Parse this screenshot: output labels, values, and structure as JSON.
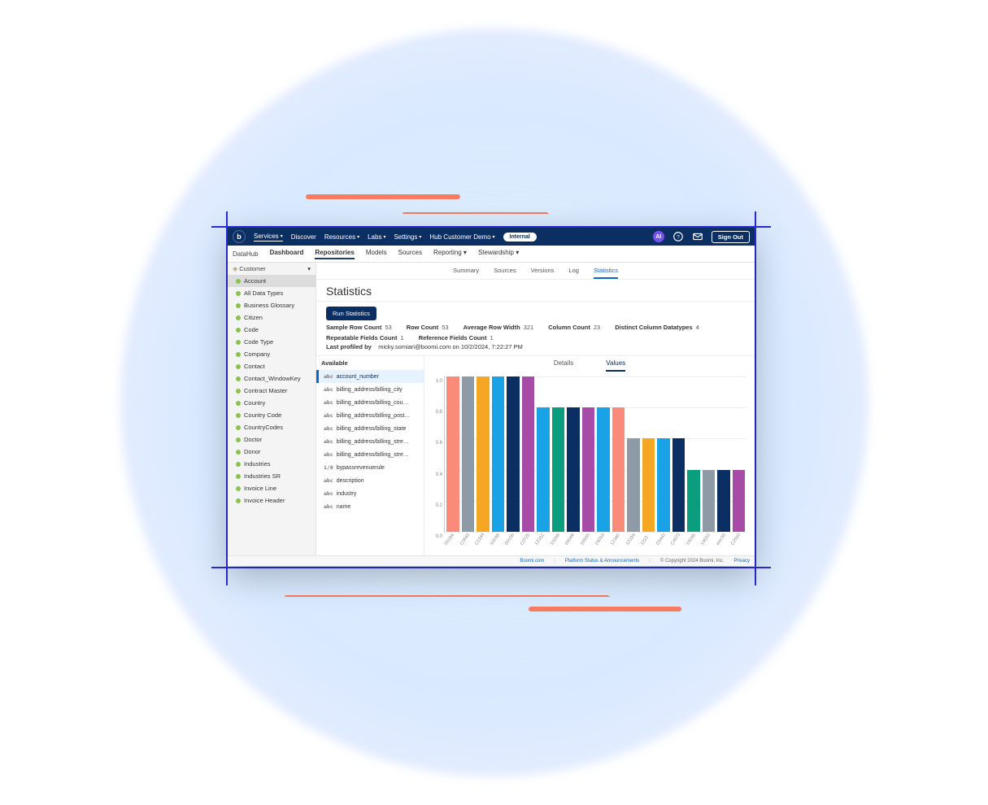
{
  "topnav": {
    "items": [
      {
        "label": "Services",
        "caret": true,
        "active": true
      },
      {
        "label": "Discover",
        "caret": false
      },
      {
        "label": "Resources",
        "caret": true
      },
      {
        "label": "Labs",
        "caret": true
      },
      {
        "label": "Settings",
        "caret": true
      },
      {
        "label": "Hub Customer Demo",
        "caret": true
      }
    ],
    "pill": "Internal",
    "ai_badge": "AI",
    "sign_out": "Sign Out"
  },
  "subnav": {
    "brand": "DataHub",
    "items": [
      "Dashboard",
      "Repositories",
      "Models",
      "Sources",
      "Reporting",
      "Stewardship"
    ],
    "bold": [
      0,
      1
    ],
    "active": 1,
    "carets": [
      4,
      5
    ]
  },
  "tree": {
    "head": "Customer",
    "items": [
      "Account",
      "All Data Types",
      "Business Glossary",
      "Citizen",
      "Code",
      "Code Type",
      "Company",
      "Contact",
      "Contact_WindowKey",
      "Contract Master",
      "Country",
      "Country Code",
      "CountryCodes",
      "Doctor",
      "Donor",
      "Industries",
      "Industries SR",
      "Invoice Line",
      "Invoice Header"
    ],
    "selected": 0
  },
  "content_tabs": {
    "items": [
      "Summary",
      "Sources",
      "Versions",
      "Log",
      "Statistics"
    ],
    "active": 4
  },
  "page": {
    "title": "Statistics",
    "run_button": "Run Statistics",
    "stats": [
      {
        "k": "Sample Row Count",
        "v": "53"
      },
      {
        "k": "Row Count",
        "v": "53"
      },
      {
        "k": "Average Row Width",
        "v": "321"
      },
      {
        "k": "Column Count",
        "v": "23"
      },
      {
        "k": "Distinct Column Datatypes",
        "v": "4"
      }
    ],
    "stats2": [
      {
        "k": "Repeatable Fields Count",
        "v": "1"
      },
      {
        "k": "Reference Fields Count",
        "v": "1"
      }
    ],
    "profiled": {
      "k": "Last profiled by",
      "v": "micky.somiari@boomi.com on 10/2/2024, 7:22:27 PM"
    }
  },
  "fields": {
    "head": "Available",
    "items": [
      {
        "type": "abc",
        "name": "account_number"
      },
      {
        "type": "abc",
        "name": "billing_address/billing_city"
      },
      {
        "type": "abc",
        "name": "billing_address/billing_cou…"
      },
      {
        "type": "abc",
        "name": "billing_address/billing_post…"
      },
      {
        "type": "abc",
        "name": "billing_address/billing_state"
      },
      {
        "type": "abc",
        "name": "billing_address/billing_stre…"
      },
      {
        "type": "abc",
        "name": "billing_address/billing_stre…"
      },
      {
        "type": "1/0",
        "name": "bypassrevenuerule"
      },
      {
        "type": "abc",
        "name": "description"
      },
      {
        "type": "abc",
        "name": "industry"
      },
      {
        "type": "abc",
        "name": "name"
      }
    ],
    "selected": 0
  },
  "chart_tabs": {
    "items": [
      "Details",
      "Values"
    ],
    "active": 1
  },
  "chart_data": {
    "type": "bar",
    "ylim": [
      0.0,
      1.0
    ],
    "yticks": [
      0.0,
      0.2,
      0.4,
      0.6,
      0.8,
      1.0
    ],
    "categories": [
      "001642771",
      "C004271",
      "C1244959",
      "10248019",
      "00105049",
      "C072507",
      "123322",
      "10245031",
      "00049908",
      "1650062006",
      "240330949-DBA",
      "1234044",
      "123246",
      "1222",
      "C644207",
      "C40734",
      "10245020",
      "14533259",
      "wsc300909",
      "C20109-4"
    ],
    "values": [
      1.0,
      1.0,
      1.0,
      1.0,
      1.0,
      1.0,
      0.8,
      0.8,
      0.8,
      0.8,
      0.8,
      0.8,
      0.6,
      0.6,
      0.6,
      0.6,
      0.4,
      0.4,
      0.4,
      0.4
    ],
    "colors": [
      "#fa8a7a",
      "#8f9aa7",
      "#f5a623",
      "#19a2e5",
      "#0b2f63",
      "#a64ca6",
      "#19a2e5",
      "#0b9e7e",
      "#0b2f63",
      "#a64ca6",
      "#19a2e5",
      "#fa8a7a",
      "#8f9aa7",
      "#f5a623",
      "#19a2e5",
      "#0b2f63",
      "#0b9e7e",
      "#8f9aa7",
      "#0b2f63",
      "#a64ca6"
    ]
  },
  "footer": {
    "boomi": "Boomi.com",
    "status": "Platform Status & Announcements",
    "copyright": "© Copyright 2024 Boomi, Inc.",
    "privacy": "Privacy"
  }
}
